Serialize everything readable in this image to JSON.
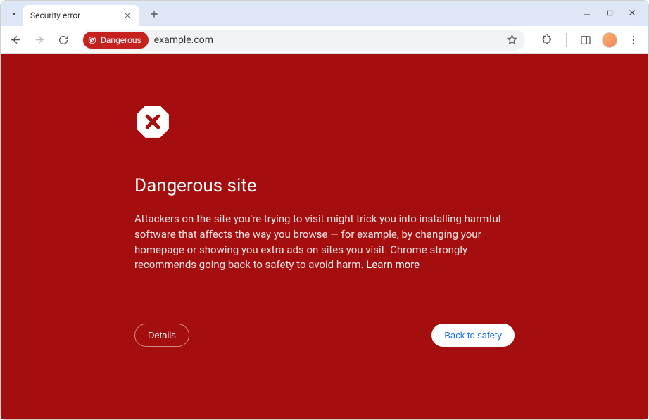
{
  "tab": {
    "title": "Security error"
  },
  "omnibox": {
    "chip_label": "Dangerous",
    "url": "example.com"
  },
  "interstitial": {
    "heading": "Dangerous site",
    "body_text": "Attackers on the site you're trying to visit might trick you into installing harmful software that affects the way you browse — for example, by changing your homepage or showing you extra ads on sites you visit. Chrome strongly recommends going back to safety to avoid harm. ",
    "learn_more": "Learn more",
    "details_label": "Details",
    "safety_label": "Back to safety"
  }
}
